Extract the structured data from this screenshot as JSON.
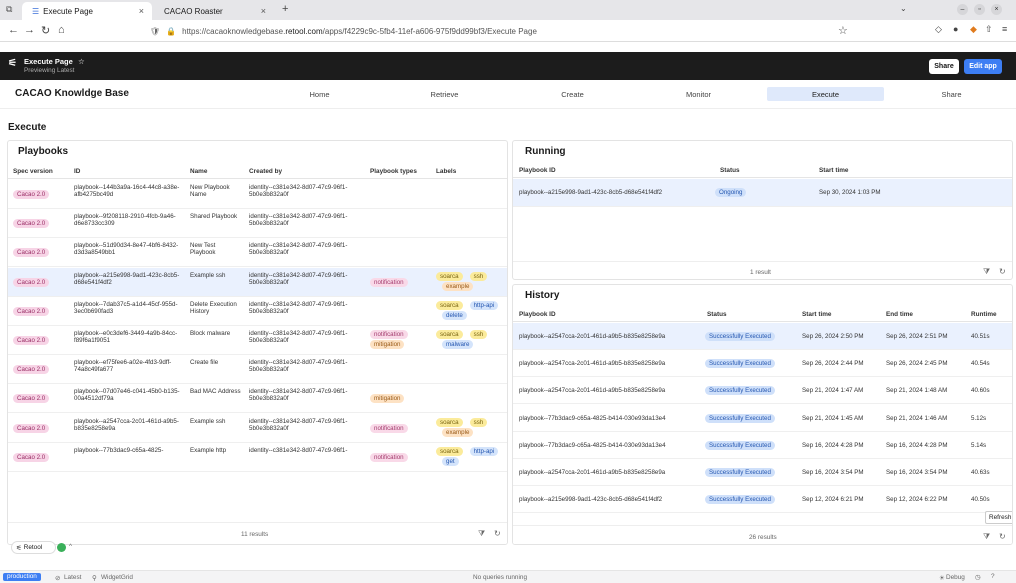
{
  "browser": {
    "tabs": [
      {
        "label": "Execute Page"
      },
      {
        "label": "CACAO Roaster"
      }
    ],
    "url_prefix": "https://cacaoknowledgebase.",
    "url_domain": "retool.com",
    "url_suffix": "/apps/f4229c9c-5fb4-11ef-a606-975f9dd99bf3/Execute Page"
  },
  "app": {
    "page_name": "Execute Page",
    "star": "☆",
    "subtitle": "Previewing   Latest",
    "share_label": "Share",
    "edit_label": "Edit app"
  },
  "brand": {
    "title": "CACAO Knowldge Base",
    "nav": [
      "Home",
      "Retrieve",
      "Create",
      "Monitor",
      "Execute",
      "Share"
    ],
    "active": "Execute"
  },
  "section_title": "Execute",
  "playbooks": {
    "title": "Playbooks",
    "columns": [
      "Spec version",
      "ID",
      "Name",
      "Created by",
      "Playbook types",
      "Labels"
    ],
    "rows": [
      {
        "spec": "Cacao 2.0",
        "id": "playbook--144b3a9a-16c4-44c8-a38e-afb4275bc49d",
        "name": "New Playbook Name",
        "created": "identity--c381e342-8d07-47c9-96f1-5b0e3b832a0f",
        "types": [],
        "labels": []
      },
      {
        "spec": "Cacao 2.0",
        "id": "playbook--9f208118-2910-4fcb-9a46-d6e8733cc309",
        "name": "Shared Playbook",
        "created": "identity--c381e342-8d07-47c9-96f1-5b0e3b832a0f",
        "types": [],
        "labels": []
      },
      {
        "spec": "Cacao 2.0",
        "id": "playbook--51d90d34-8e47-4bf6-8432-d3d3a8549bb1",
        "name": "New Test Playbook",
        "created": "identity--c381e342-8d07-47c9-96f1-5b0e3b832a0f",
        "types": [],
        "labels": []
      },
      {
        "spec": "Cacao 2.0",
        "id": "playbook--a215e998-9ad1-423c-8cb5-d68e541f4df2",
        "name": "Example ssh",
        "created": "identity--c381e342-8d07-47c9-96f1-5b0e3b832a0f",
        "types": [
          "notification"
        ],
        "labels": [
          "soarca",
          "ssh",
          "example"
        ]
      },
      {
        "spec": "Cacao 2.0",
        "id": "playbook--7dab37c5-a1d4-45cf-955d-3ec0b690fad3",
        "name": "Delete Execution History",
        "created": "identity--c381e342-8d07-47c9-96f1-5b0e3b832a0f",
        "types": [],
        "labels": [
          "soarca",
          "http-api",
          "delete"
        ]
      },
      {
        "spec": "Cacao 2.0",
        "id": "playbook--e0c3def6-3449-4a9b-84cc-f89f6a1f9051",
        "name": "Block malware",
        "created": "identity--c381e342-8d07-47c9-96f1-5b0e3b832a0f",
        "types": [
          "notification",
          "mitigation"
        ],
        "labels": [
          "soarca",
          "ssh",
          "malware"
        ]
      },
      {
        "spec": "Cacao 2.0",
        "id": "playbook--ef75fee6-a02e-4fd3-9dff-74a8c49fa677",
        "name": "Create file",
        "created": "identity--c381e342-8d07-47c9-96f1-5b0e3b832a0f",
        "types": [],
        "labels": []
      },
      {
        "spec": "Cacao 2.0",
        "id": "playbook--07d07e46-c041-45b0-b135-00a4512df79a",
        "name": "Bad MAC Address",
        "created": "identity--c381e342-8d07-47c9-96f1-5b0e3b832a0f",
        "types": [
          "mitigation"
        ],
        "labels": []
      },
      {
        "spec": "Cacao 2.0",
        "id": "playbook--a2547cca-2c01-461d-a9b5-b835e8258e9a",
        "name": "Example ssh",
        "created": "identity--c381e342-8d07-47c9-96f1-5b0e3b832a0f",
        "types": [
          "notification"
        ],
        "labels": [
          "soarca",
          "ssh",
          "example"
        ]
      },
      {
        "spec": "Cacao 2.0",
        "id": "playbook--77b3dac9-c65a-4825-",
        "name": "Example http",
        "created": "identity--c381e342-8d07-47c9-96f1-",
        "types": [
          "notification"
        ],
        "labels": [
          "soarca",
          "http-api",
          "get"
        ]
      }
    ],
    "results": "11 results"
  },
  "running": {
    "title": "Running",
    "columns": [
      "Playbook ID",
      "Status",
      "Start time"
    ],
    "rows": [
      {
        "id": "playbook--a215e998-9ad1-423c-8cb5-d68e541f4df2",
        "status": "Ongoing",
        "start": "Sep 30, 2024 1:03 PM"
      }
    ],
    "results": "1 result"
  },
  "history": {
    "title": "History",
    "columns": [
      "Playbook ID",
      "Status",
      "Start time",
      "End time",
      "Runtime"
    ],
    "rows": [
      {
        "id": "playbook--a2547cca-2c01-461d-a9b5-b835e8258e9a",
        "status": "Successfully Executed",
        "start": "Sep 26, 2024 2:50 PM",
        "end": "Sep 26, 2024 2:51 PM",
        "runtime": "40.51s"
      },
      {
        "id": "playbook--a2547cca-2c01-461d-a9b5-b835e8258e9a",
        "status": "Successfully Executed",
        "start": "Sep 26, 2024 2:44 PM",
        "end": "Sep 26, 2024 2:45 PM",
        "runtime": "40.54s"
      },
      {
        "id": "playbook--a2547cca-2c01-461d-a9b5-b835e8258e9a",
        "status": "Successfully Executed",
        "start": "Sep 21, 2024 1:47 AM",
        "end": "Sep 21, 2024 1:48 AM",
        "runtime": "40.60s"
      },
      {
        "id": "playbook--77b3dac9-c65a-4825-b414-030e93da13e4",
        "status": "Successfully Executed",
        "start": "Sep 21, 2024 1:45 AM",
        "end": "Sep 21, 2024 1:46 AM",
        "runtime": "5.12s"
      },
      {
        "id": "playbook--77b3dac9-c65a-4825-b414-030e93da13e4",
        "status": "Successfully Executed",
        "start": "Sep 16, 2024 4:28 PM",
        "end": "Sep 16, 2024 4:28 PM",
        "runtime": "5.14s"
      },
      {
        "id": "playbook--a2547cca-2c01-461d-a9b5-b835e8258e9a",
        "status": "Successfully Executed",
        "start": "Sep 16, 2024 3:54 PM",
        "end": "Sep 16, 2024 3:54 PM",
        "runtime": "40.63s"
      },
      {
        "id": "playbook--a215e998-9ad1-423c-8cb5-d68e541f4df2",
        "status": "Successfully Executed",
        "start": "Sep 12, 2024 6:21 PM",
        "end": "Sep 12, 2024 6:22 PM",
        "runtime": "40.50s"
      }
    ],
    "results": "26 results",
    "tooltip": "Refresh"
  },
  "retool_badge": "Retool",
  "statusbar": {
    "env": "production",
    "latest": "Latest",
    "widget": "WidgetGrid",
    "queries": "No queries running",
    "debug": "Debug"
  },
  "colors": {
    "cacao": "#f7d4e6",
    "notification": "#f9d9e8",
    "mitigation": "#fde2c4",
    "soarca": "#fbeb9b",
    "blue": "#d4e4fb",
    "ongoing": "#cfe0fa",
    "success": "#cfe0fa"
  }
}
